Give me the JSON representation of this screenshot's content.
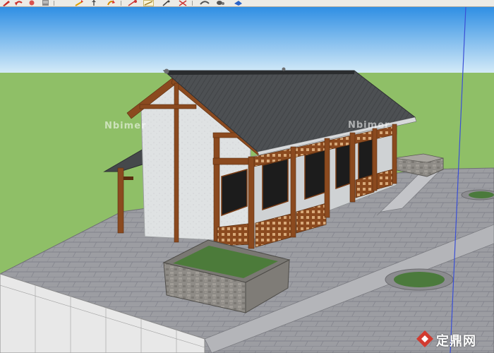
{
  "toolbar": {
    "tools": [
      {
        "name": "pencil-tool",
        "icon": "pencil-icon"
      },
      {
        "name": "undo-tool",
        "icon": "undo-icon"
      },
      {
        "name": "paint-tool",
        "icon": "paint-bucket-icon"
      },
      {
        "name": "material-tool",
        "icon": "material-icon"
      },
      {
        "name": "move-tool",
        "icon": "move-icon"
      },
      {
        "name": "push-pull-tool",
        "icon": "push-pull-icon"
      },
      {
        "name": "rotate-tool",
        "icon": "rotate-icon"
      },
      {
        "name": "scale-tool",
        "icon": "scale-icon"
      },
      {
        "name": "tape-tool",
        "icon": "tape-measure-icon"
      },
      {
        "name": "orbit-tool",
        "icon": "orbit-icon"
      },
      {
        "name": "pan-tool",
        "icon": "pan-icon"
      },
      {
        "name": "zoom-tool",
        "icon": "zoom-icon"
      }
    ]
  },
  "watermark": {
    "center": "Nbimer",
    "right": "Nbimer"
  },
  "logo": {
    "text": "定鼎网"
  },
  "colors": {
    "sky_top": "#2f8fe4",
    "sky_bottom": "#d7ecf8",
    "ground": "#8fbf67",
    "roof": "#4a4d50",
    "wall": "#dfe2e3",
    "timber": "#8b4a1f",
    "paving": "#9c9da2",
    "axis_blue": "#3a4fd6"
  }
}
